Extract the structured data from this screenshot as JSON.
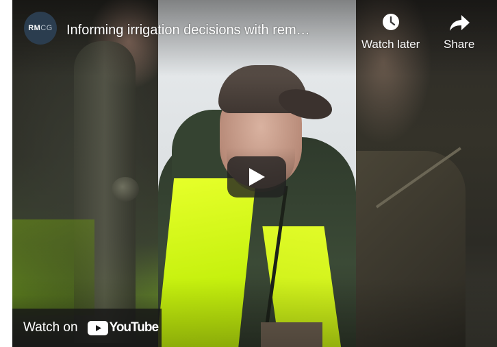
{
  "video": {
    "title": "Informing irrigation decisions with rem…"
  },
  "channel": {
    "avatar_text_strong": "RM",
    "avatar_text_light": "CG"
  },
  "actions": {
    "watch_later": "Watch later",
    "share": "Share"
  },
  "footer": {
    "watch_on": "Watch on",
    "brand": "YouTube"
  },
  "icons": {
    "watch_later": "clock-icon",
    "share": "share-arrow-icon",
    "play": "play-icon",
    "brand": "youtube-logo-icon"
  },
  "colors": {
    "youtube_red": "#ff0000",
    "avatar_bg": "#2b3d4f",
    "play_button_bg": "#212121"
  }
}
